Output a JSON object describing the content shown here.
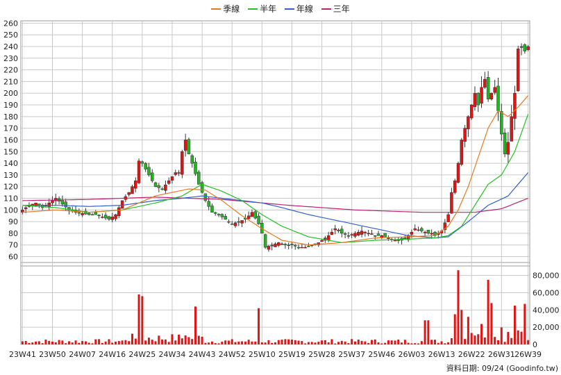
{
  "legend": {
    "items": [
      {
        "label": "季線",
        "color": "#e8781e"
      },
      {
        "label": "半年",
        "color": "#22c022"
      },
      {
        "label": "年線",
        "color": "#3060d0"
      },
      {
        "label": "三年",
        "color": "#c02070"
      }
    ]
  },
  "credit": "資料日期: 09/24  (Goodinfo.tw)",
  "colors": {
    "up": "#e11414",
    "down": "#22b422",
    "volume": "#e11414",
    "grid": "#c8c8c8"
  },
  "chart_data": {
    "type": "candlestick+volume",
    "price_axis": {
      "ylim": [
        52,
        262
      ],
      "ticks": [
        60,
        70,
        80,
        90,
        100,
        110,
        120,
        130,
        140,
        150,
        160,
        170,
        180,
        190,
        200,
        210,
        220,
        230,
        240,
        250,
        260
      ]
    },
    "volume_axis": {
      "ylim": [
        0,
        95000
      ],
      "ticks": [
        0,
        20000,
        40000,
        60000,
        80000
      ],
      "tick_labels": [
        "0",
        "20,000",
        "40,000",
        "60,000",
        "80,000"
      ]
    },
    "x_labels": [
      "23W41",
      "23W50",
      "24W07",
      "24W16",
      "24W25",
      "24W34",
      "24W43",
      "24W52",
      "25W10",
      "25W19",
      "25W28",
      "25W37",
      "25W46",
      "26W03",
      "26W13",
      "26W22",
      "26W31",
      "26W39"
    ],
    "x_label_index": [
      0,
      9,
      18,
      27,
      36,
      45,
      54,
      63,
      72,
      81,
      90,
      99,
      108,
      117,
      126,
      135,
      144,
      152
    ],
    "price_knots": [
      [
        0,
        100
      ],
      [
        2,
        104
      ],
      [
        4,
        106
      ],
      [
        6,
        102
      ],
      [
        8,
        106
      ],
      [
        10,
        110
      ],
      [
        12,
        105
      ],
      [
        14,
        100
      ],
      [
        16,
        98
      ],
      [
        18,
        97
      ],
      [
        20,
        96
      ],
      [
        22,
        96
      ],
      [
        24,
        94
      ],
      [
        26,
        92
      ],
      [
        28,
        96
      ],
      [
        30,
        108
      ],
      [
        32,
        115
      ],
      [
        34,
        125
      ],
      [
        35,
        142
      ],
      [
        36,
        140
      ],
      [
        38,
        130
      ],
      [
        40,
        120
      ],
      [
        42,
        118
      ],
      [
        44,
        125
      ],
      [
        46,
        132
      ],
      [
        47,
        132
      ],
      [
        48,
        150
      ],
      [
        49,
        160
      ],
      [
        50,
        148
      ],
      [
        51,
        140
      ],
      [
        53,
        122
      ],
      [
        55,
        108
      ],
      [
        57,
        98
      ],
      [
        59,
        96
      ],
      [
        61,
        92
      ],
      [
        63,
        88
      ],
      [
        65,
        90
      ],
      [
        67,
        92
      ],
      [
        69,
        98
      ],
      [
        71,
        88
      ],
      [
        72,
        80
      ],
      [
        73,
        68
      ],
      [
        75,
        70
      ],
      [
        77,
        72
      ],
      [
        79,
        70
      ],
      [
        81,
        70
      ],
      [
        83,
        68
      ],
      [
        85,
        68
      ],
      [
        87,
        70
      ],
      [
        89,
        72
      ],
      [
        90,
        74
      ],
      [
        92,
        78
      ],
      [
        94,
        84
      ],
      [
        96,
        80
      ],
      [
        98,
        78
      ],
      [
        100,
        80
      ],
      [
        102,
        82
      ],
      [
        104,
        80
      ],
      [
        106,
        78
      ],
      [
        108,
        78
      ],
      [
        110,
        76
      ],
      [
        112,
        74
      ],
      [
        114,
        74
      ],
      [
        116,
        78
      ],
      [
        118,
        84
      ],
      [
        120,
        82
      ],
      [
        122,
        80
      ],
      [
        123,
        80
      ],
      [
        124,
        78
      ],
      [
        126,
        82
      ],
      [
        128,
        96
      ],
      [
        129,
        115
      ],
      [
        130,
        125
      ],
      [
        131,
        140
      ],
      [
        132,
        160
      ],
      [
        134,
        180
      ],
      [
        136,
        200
      ],
      [
        137,
        190
      ],
      [
        138,
        205
      ],
      [
        139,
        212
      ],
      [
        140,
        195
      ],
      [
        141,
        200
      ],
      [
        142,
        205
      ],
      [
        144,
        165
      ],
      [
        145,
        148
      ],
      [
        146,
        158
      ],
      [
        147,
        180
      ],
      [
        148,
        200
      ],
      [
        149,
        238
      ],
      [
        150,
        240
      ],
      [
        151,
        236
      ],
      [
        152,
        240
      ]
    ],
    "volume_spikes": [
      [
        35,
        58000
      ],
      [
        36,
        56000
      ],
      [
        52,
        44000
      ],
      [
        71,
        42000
      ],
      [
        121,
        28000
      ],
      [
        122,
        28000
      ],
      [
        130,
        35000
      ],
      [
        131,
        86000
      ],
      [
        132,
        40000
      ],
      [
        134,
        32000
      ],
      [
        140,
        75000
      ],
      [
        141,
        48000
      ],
      [
        148,
        45000
      ],
      [
        151,
        47000
      ]
    ],
    "ma_quarter": [
      [
        0,
        98
      ],
      [
        10,
        100
      ],
      [
        20,
        98
      ],
      [
        30,
        100
      ],
      [
        40,
        112
      ],
      [
        50,
        118
      ],
      [
        55,
        117
      ],
      [
        60,
        108
      ],
      [
        66,
        95
      ],
      [
        72,
        84
      ],
      [
        78,
        74
      ],
      [
        86,
        70
      ],
      [
        96,
        72
      ],
      [
        106,
        76
      ],
      [
        116,
        77
      ],
      [
        124,
        78
      ],
      [
        128,
        86
      ],
      [
        131,
        100
      ],
      [
        134,
        120
      ],
      [
        137,
        145
      ],
      [
        140,
        170
      ],
      [
        143,
        185
      ],
      [
        146,
        180
      ],
      [
        149,
        188
      ],
      [
        152,
        198
      ]
    ],
    "ma_half": [
      [
        0,
        104
      ],
      [
        10,
        102
      ],
      [
        20,
        98
      ],
      [
        30,
        100
      ],
      [
        40,
        106
      ],
      [
        48,
        112
      ],
      [
        54,
        122
      ],
      [
        60,
        116
      ],
      [
        66,
        108
      ],
      [
        72,
        96
      ],
      [
        78,
        86
      ],
      [
        86,
        77
      ],
      [
        96,
        72
      ],
      [
        106,
        74
      ],
      [
        116,
        75
      ],
      [
        124,
        76
      ],
      [
        128,
        78
      ],
      [
        132,
        86
      ],
      [
        136,
        104
      ],
      [
        140,
        122
      ],
      [
        144,
        130
      ],
      [
        148,
        150
      ],
      [
        152,
        182
      ]
    ],
    "ma_year": [
      [
        0,
        104
      ],
      [
        10,
        104
      ],
      [
        20,
        103
      ],
      [
        30,
        104
      ],
      [
        40,
        108
      ],
      [
        48,
        110
      ],
      [
        54,
        112
      ],
      [
        60,
        110
      ],
      [
        66,
        108
      ],
      [
        72,
        106
      ],
      [
        78,
        102
      ],
      [
        86,
        96
      ],
      [
        96,
        90
      ],
      [
        106,
        84
      ],
      [
        116,
        78
      ],
      [
        124,
        76
      ],
      [
        128,
        77
      ],
      [
        134,
        90
      ],
      [
        140,
        104
      ],
      [
        146,
        112
      ],
      [
        152,
        132
      ]
    ],
    "ma_three": [
      [
        0,
        108
      ],
      [
        20,
        109
      ],
      [
        40,
        111
      ],
      [
        60,
        109
      ],
      [
        80,
        104
      ],
      [
        100,
        100
      ],
      [
        120,
        98
      ],
      [
        128,
        98
      ],
      [
        136,
        98
      ],
      [
        144,
        101
      ],
      [
        152,
        110
      ]
    ]
  }
}
